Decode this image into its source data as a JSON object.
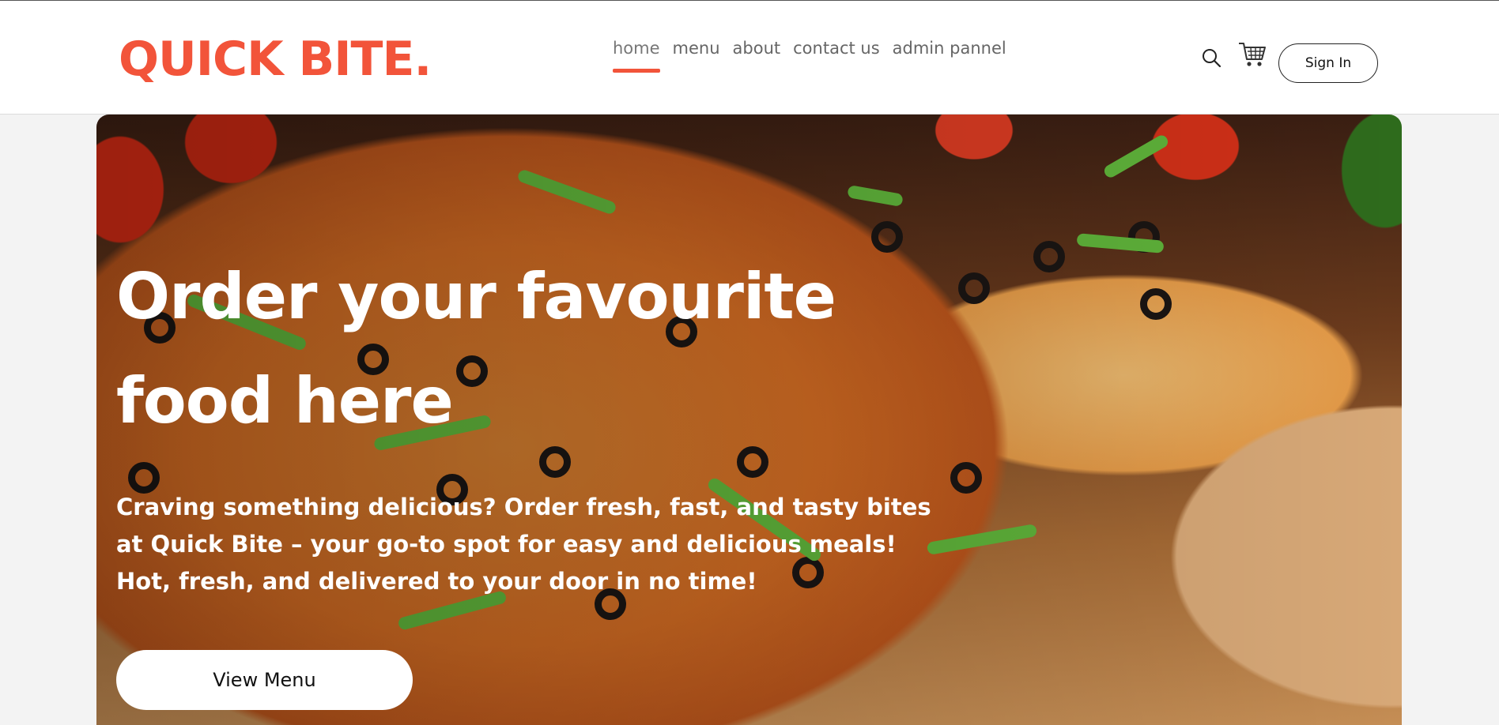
{
  "brand": {
    "logo_text": "QUICK BITE.",
    "accent_color": "#f2543a"
  },
  "nav": {
    "items": [
      {
        "label": "home",
        "active": true
      },
      {
        "label": "menu",
        "active": false
      },
      {
        "label": "about",
        "active": false
      },
      {
        "label": "contact us",
        "active": false
      },
      {
        "label": "admin pannel",
        "active": false
      }
    ]
  },
  "header_actions": {
    "search_icon": "search-icon",
    "cart_icon": "cart-icon",
    "signin_label": "Sign In"
  },
  "hero": {
    "image": "pizza-photo",
    "title": "Order your favourite food here",
    "subtitle": "Craving something delicious? Order fresh, fast, and tasty bites at Quick Bite – your go-to spot for easy and delicious meals! Hot, fresh, and delivered to your door in no time!",
    "cta_label": "View Menu"
  }
}
